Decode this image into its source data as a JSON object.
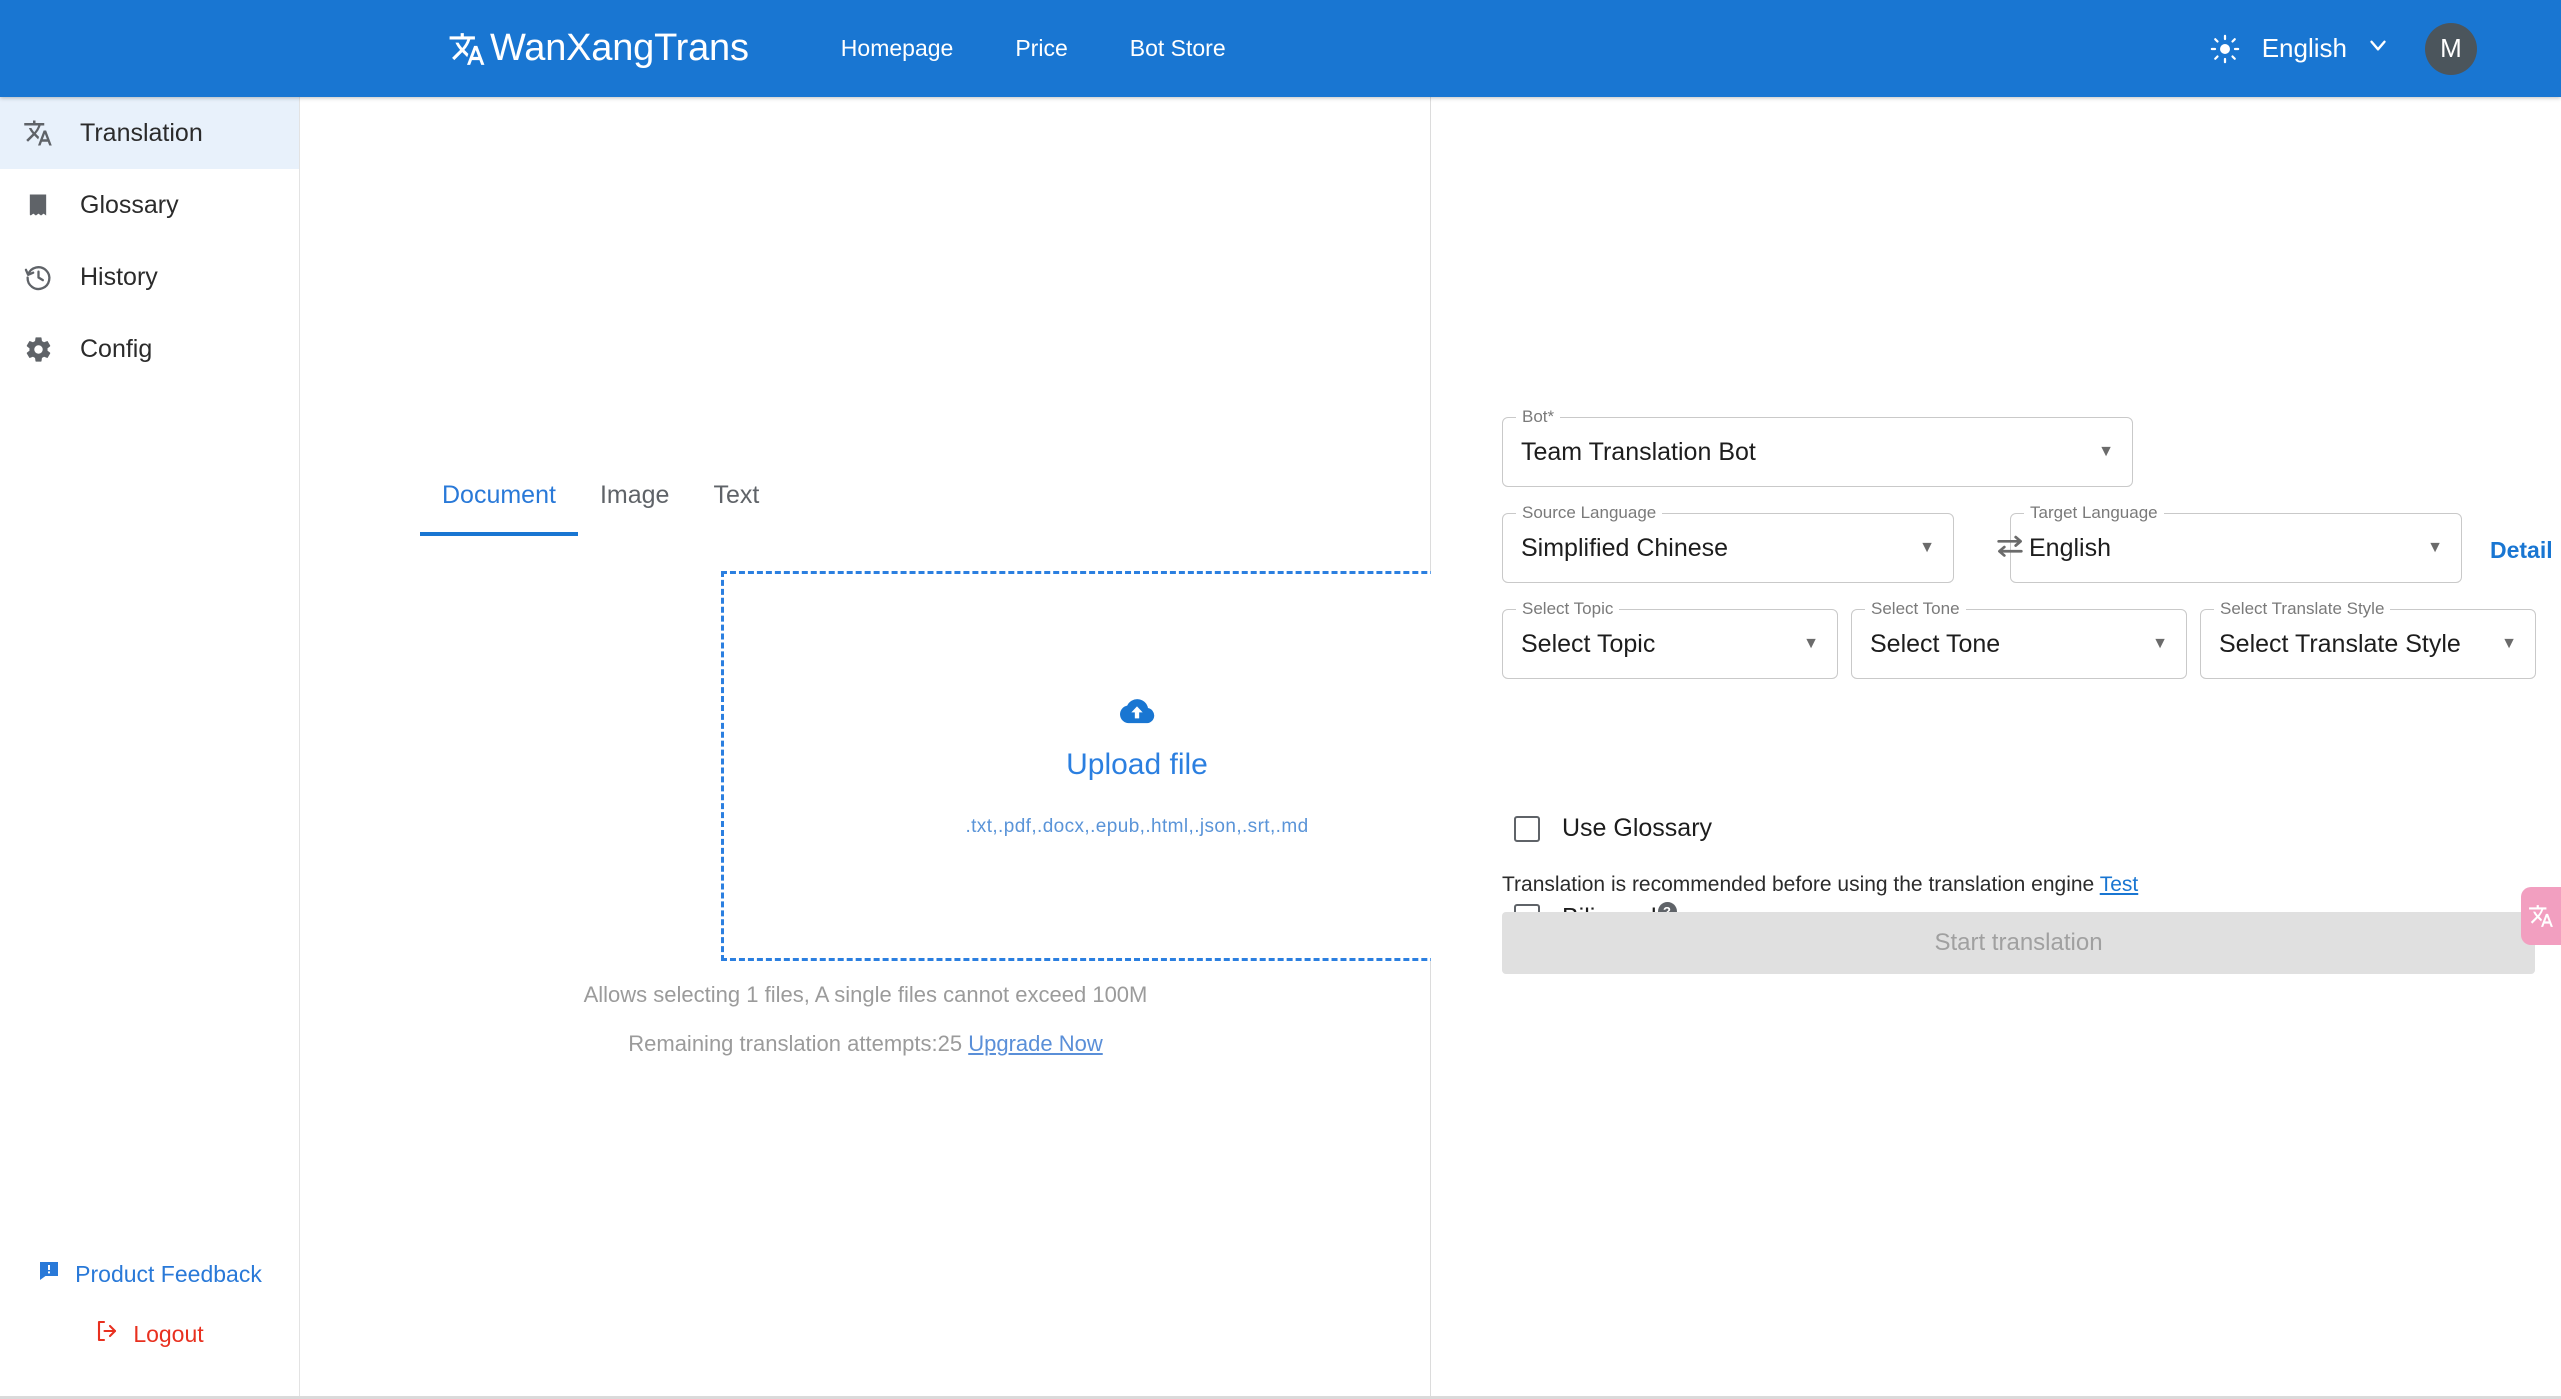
{
  "header": {
    "brand": "WanXangTrans",
    "brand_icon": "translate-icon",
    "nav": [
      {
        "label": "Homepage"
      },
      {
        "label": "Price"
      },
      {
        "label": "Bot Store"
      }
    ],
    "theme_toggle_icon": "sun-icon",
    "language": "English",
    "language_caret_icon": "chevron-down-icon",
    "avatar_initial": "M",
    "accent_color": "#1976d2"
  },
  "sidebar": {
    "items": [
      {
        "label": "Translation",
        "icon": "translate-icon",
        "active": true
      },
      {
        "label": "Glossary",
        "icon": "book-list-icon",
        "active": false
      },
      {
        "label": "History",
        "icon": "history-clock-icon",
        "active": false
      },
      {
        "label": "Config",
        "icon": "gear-icon",
        "active": false
      }
    ],
    "feedback": {
      "label": "Product Feedback",
      "icon": "feedback-bubble-icon",
      "color": "#2979d8"
    },
    "logout": {
      "label": "Logout",
      "icon": "logout-arrow-icon",
      "color": "#e8301f"
    }
  },
  "left_panel": {
    "tabs": [
      {
        "label": "Document",
        "active": true
      },
      {
        "label": "Image",
        "active": false
      },
      {
        "label": "Text",
        "active": false
      }
    ],
    "dropzone": {
      "icon": "cloud-upload-icon",
      "title": "Upload file",
      "formats": ".txt,.pdf,.docx,.epub,.html,.json,.srt,.md"
    },
    "hint_files": "Allows selecting 1 files, A single files cannot exceed 100M",
    "hint_attempts_text": "Remaining translation attempts:25",
    "hint_attempts_link": "Upgrade Now"
  },
  "right_panel": {
    "bot": {
      "legend": "Bot",
      "required_mark": "*",
      "value": "Team Translation Bot",
      "caret_icon": "caret-down-icon"
    },
    "detail_link": "Detail",
    "source_language": {
      "legend": "Source Language",
      "value": "Simplified Chinese",
      "caret_icon": "caret-down-icon"
    },
    "swap_icon": "swap-horizontal-icon",
    "target_language": {
      "legend": "Target Language",
      "value": "English",
      "caret_icon": "caret-down-icon"
    },
    "topic": {
      "legend": "Select Topic",
      "value": "Select Topic",
      "caret_icon": "caret-down-icon"
    },
    "tone": {
      "legend": "Select Tone",
      "value": "Select Tone",
      "caret_icon": "caret-down-icon"
    },
    "translate_style": {
      "legend": "Select Translate Style",
      "value": "Select Translate Style",
      "caret_icon": "caret-down-icon"
    },
    "use_glossary": {
      "label": "Use Glossary",
      "checked": false
    },
    "bilingual": {
      "label": "Bilingual",
      "checked": false,
      "help_icon": "question-mark-icon",
      "help_glyph": "?"
    },
    "engine_note": "Translation is recommended before using the translation engine",
    "engine_note_link": "Test",
    "start_button": {
      "label": "Start translation",
      "disabled": true
    }
  },
  "float_widget": {
    "icon": "translate-widget-icon",
    "color": "#f29fc0"
  }
}
